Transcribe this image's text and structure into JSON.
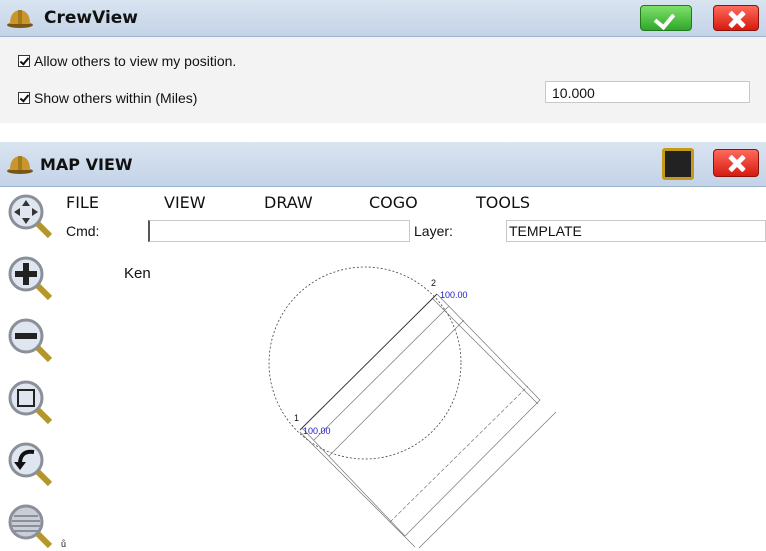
{
  "crewview": {
    "title": "CrewView",
    "allow_label": "Allow others to view my position.",
    "show_label": "Show others within (Miles)",
    "miles_value": "10.000"
  },
  "mapview": {
    "title": "MAP VIEW",
    "menu": [
      "FILE",
      "VIEW",
      "DRAW",
      "COGO",
      "TOOLS"
    ],
    "cmd_label": "Cmd:",
    "cmd_value": "",
    "layer_label": "Layer:",
    "layer_value": "TEMPLATE",
    "map": {
      "crew_name": "Ken",
      "point1_id": "1",
      "point1_elev": "100.00",
      "point2_id": "2",
      "point2_elev": "100.00",
      "corner_label": "ů"
    }
  },
  "colors": {
    "titlebar": "#c9d7ea",
    "ok": "#3fbf34",
    "cancel": "#e8251a",
    "elev_text": "#1a1acc"
  },
  "icons": [
    "hardhat-icon",
    "check-icon",
    "close-icon",
    "stop-icon",
    "zoom-pan-icon",
    "zoom-in-icon",
    "zoom-out-icon",
    "zoom-window-icon",
    "zoom-previous-icon",
    "zoom-extents-icon"
  ]
}
